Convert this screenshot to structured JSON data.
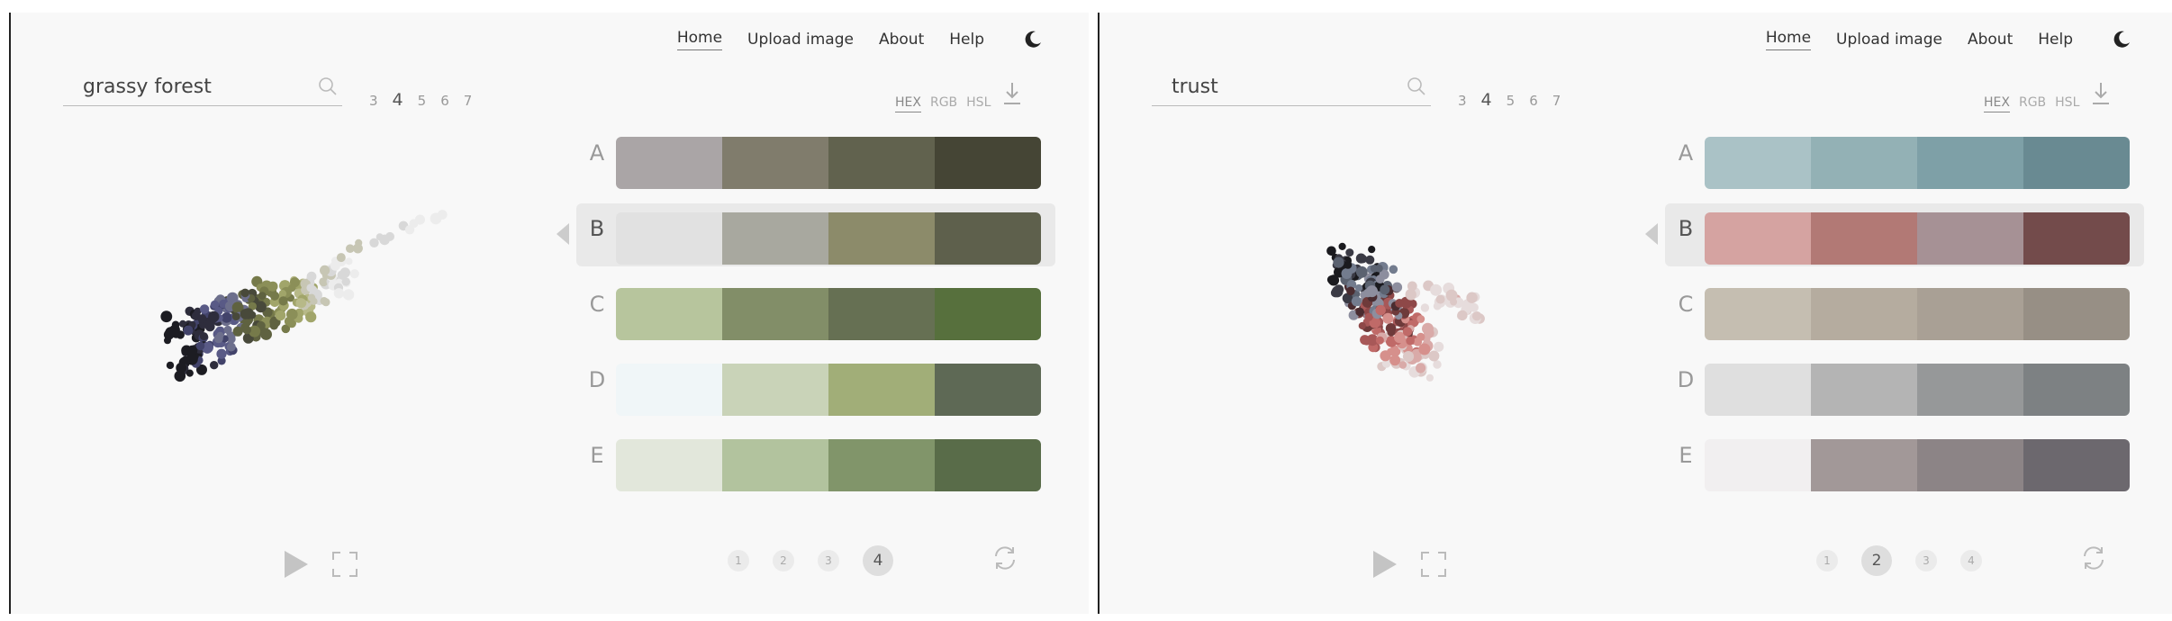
{
  "nav": {
    "home": "Home",
    "upload": "Upload image",
    "about": "About",
    "help": "Help"
  },
  "icons": {
    "search": "search-icon",
    "moon": "moon-icon",
    "download": "download-icon",
    "play": "play-icon",
    "fullscreen": "fullscreen-icon",
    "refresh": "refresh-icon"
  },
  "formats": [
    "HEX",
    "RGB",
    "HSL"
  ],
  "panels": [
    {
      "search_value": "grassy forest",
      "counts": [
        "3",
        "4",
        "5",
        "6",
        "7"
      ],
      "selected_count": "4",
      "selected_format": "HEX",
      "selected_row": "B",
      "pages": [
        "1",
        "2",
        "3",
        "4"
      ],
      "selected_page": "4",
      "rows": [
        {
          "label": "A",
          "colors": [
            "#aaa5a6",
            "#807c6c",
            "#61624e",
            "#454535"
          ]
        },
        {
          "label": "B",
          "colors": [
            "#e1e1e1",
            "#a8a89f",
            "#8c8b6a",
            "#5e604c"
          ]
        },
        {
          "label": "C",
          "colors": [
            "#b7c59d",
            "#828e68",
            "#667053",
            "#57703d"
          ]
        },
        {
          "label": "D",
          "colors": [
            "#f0f6f8",
            "#c9d3b8",
            "#a1ae78",
            "#5e6955"
          ]
        },
        {
          "label": "E",
          "colors": [
            "#e2e7db",
            "#b2c39e",
            "#81956a",
            "#596c49"
          ]
        }
      ],
      "scatter_palette": [
        "#1c1c22",
        "#2e2d3c",
        "#42436a",
        "#595a86",
        "#6d6f8c",
        "#48493a",
        "#5f6240",
        "#767a4a",
        "#8b8f58",
        "#a1a56a",
        "#b7b988",
        "#c7c6b4",
        "#d8d8d8",
        "#ececec"
      ]
    },
    {
      "search_value": "trust",
      "counts": [
        "3",
        "4",
        "5",
        "6",
        "7"
      ],
      "selected_count": "4",
      "selected_format": "HEX",
      "selected_row": "B",
      "pages": [
        "1",
        "2",
        "3",
        "4"
      ],
      "selected_page": "2",
      "rows": [
        {
          "label": "A",
          "colors": [
            "#aac2c6",
            "#93b1b5",
            "#7ea0a7",
            "#698a92"
          ]
        },
        {
          "label": "B",
          "colors": [
            "#d5a3a1",
            "#b27975",
            "#a69195",
            "#734b4b"
          ]
        },
        {
          "label": "C",
          "colors": [
            "#c5beb1",
            "#b5ac9f",
            "#a9a095",
            "#978f85"
          ]
        },
        {
          "label": "D",
          "colors": [
            "#dfdfdf",
            "#b4b4b4",
            "#969899",
            "#7d8183"
          ]
        },
        {
          "label": "E",
          "colors": [
            "#f1eff0",
            "#a29898",
            "#8c8486",
            "#6c686e"
          ]
        }
      ],
      "scatter_palette": [
        "#1a1a1e",
        "#3a3a44",
        "#5b6270",
        "#737c8e",
        "#8d8e9e",
        "#4a2c30",
        "#6e3a3a",
        "#8e4848",
        "#a85858",
        "#c06a68",
        "#d6908c",
        "#d9aaa8",
        "#dcc8c6",
        "#e6dcdc"
      ]
    }
  ]
}
